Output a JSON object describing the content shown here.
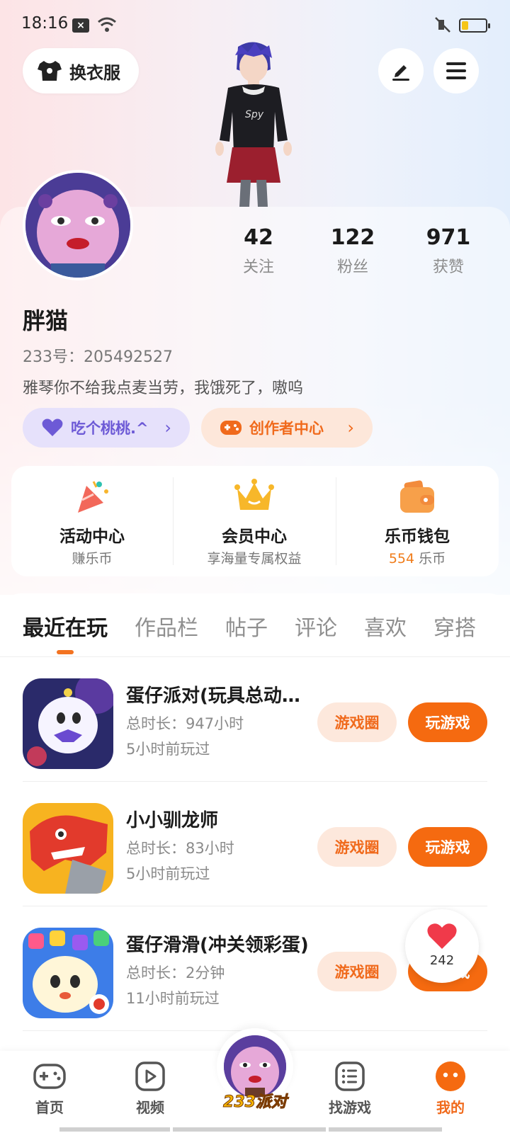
{
  "status": {
    "time": "18:16",
    "x_icon": "x-notification-icon",
    "wifi_icon": "wifi-icon",
    "mute_icon": "mute-icon",
    "battery_icon": "battery-icon"
  },
  "header": {
    "outfit_label": "换衣服",
    "edit_icon": "pen-icon",
    "menu_icon": "menu-icon"
  },
  "profile": {
    "stats": [
      {
        "num": "42",
        "label": "关注"
      },
      {
        "num": "122",
        "label": "粉丝"
      },
      {
        "num": "971",
        "label": "获赞"
      }
    ],
    "nickname": "胖猫",
    "uid": "233号：205492527",
    "bio": "雅琴你不给我点麦当劳，我饿死了，嗷呜",
    "pills": [
      {
        "label": "吃个桃桃.^",
        "icon": "heart-icon"
      },
      {
        "label": "创作者中心",
        "icon": "gamepad-icon"
      }
    ]
  },
  "entries": [
    {
      "title": "活动中心",
      "sub": "赚乐币",
      "icon": "party-icon"
    },
    {
      "title": "会员中心",
      "sub": "享海量专属权益",
      "icon": "crown-icon"
    },
    {
      "title": "乐币钱包",
      "sub_highlight": "554",
      "sub": "乐币",
      "icon": "wallet-icon"
    }
  ],
  "tabs": [
    "最近在玩",
    "作品栏",
    "帖子",
    "评论",
    "喜欢",
    "穿搭"
  ],
  "games": [
    {
      "name": "蛋仔派对(玩具总动员联动)",
      "time": "总时长：947小时",
      "last": "5小时前玩过",
      "btn_circle": "游戏圈",
      "btn_play": "玩游戏"
    },
    {
      "name": "小小驯龙师",
      "time": "总时长：83小时",
      "last": "5小时前玩过",
      "btn_circle": "游戏圈",
      "btn_play": "玩游戏"
    },
    {
      "name": "蛋仔滑滑(冲关领彩蛋)",
      "time": "总时长：2分钟",
      "last": "11小时前玩过",
      "btn_circle": "游戏圈",
      "btn_play": "玩游戏"
    }
  ],
  "like_float": {
    "count": "242",
    "icon": "heart-icon"
  },
  "nav": [
    {
      "label": "首页",
      "icon": "gamepad-icon"
    },
    {
      "label": "视频",
      "icon": "play-icon"
    },
    {
      "label": "233派对",
      "icon": "party-avatar-icon"
    },
    {
      "label": "找游戏",
      "icon": "list-icon"
    },
    {
      "label": "我的",
      "icon": "face-icon"
    }
  ],
  "colors": {
    "accent": "#f56a10",
    "purple": "#6d5ad6"
  }
}
